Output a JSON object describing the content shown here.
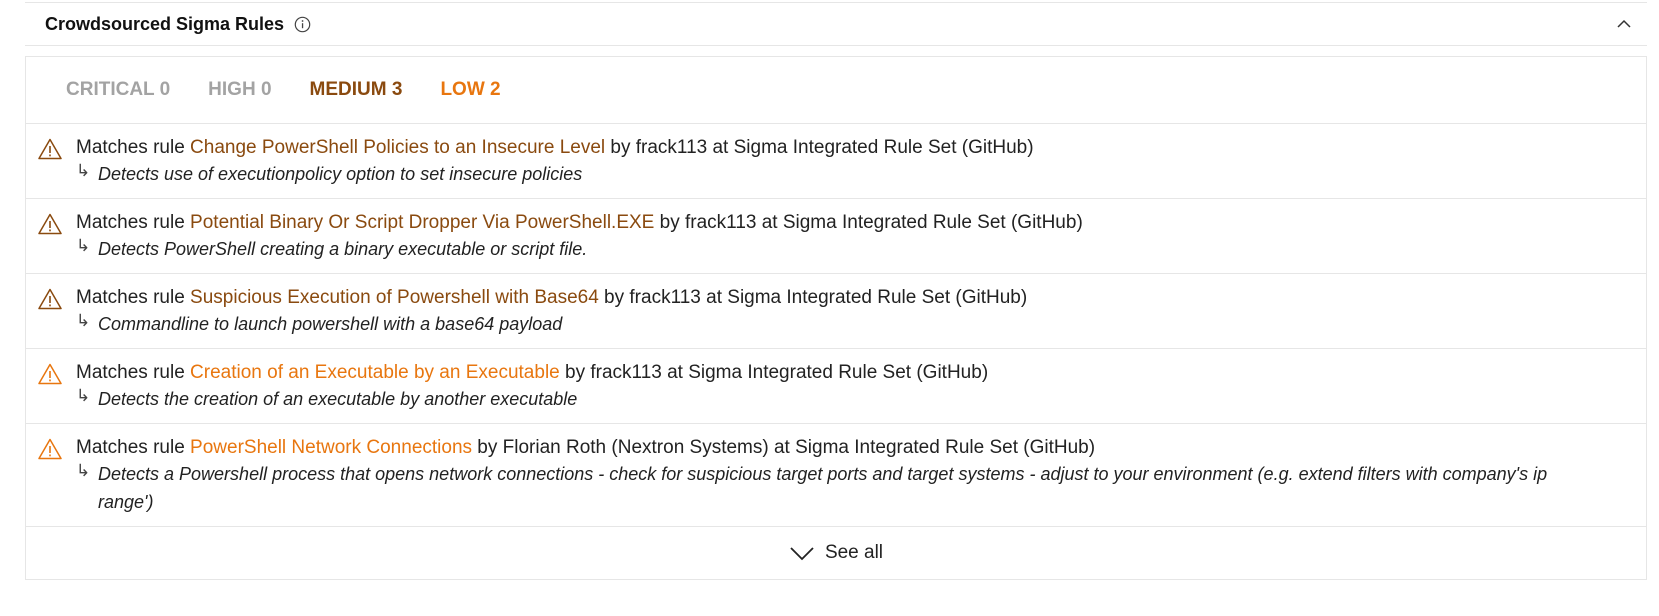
{
  "section": {
    "title": "Crowdsourced Sigma Rules"
  },
  "counts": {
    "critical": "CRITICAL 0",
    "high": "HIGH 0",
    "medium": "MEDIUM 3",
    "low": "LOW 2"
  },
  "colors": {
    "medium": "#8a4a0f",
    "low": "#e8760f",
    "muted": "#a3a3a3"
  },
  "rules": [
    {
      "prefix": "Matches rule ",
      "name": "Change PowerShell Policies to an Insecure Level",
      "suffix": " by frack113 at Sigma Integrated Rule Set (GitHub)",
      "description": "Detects use of executionpolicy option to set insecure policies",
      "severity": "medium"
    },
    {
      "prefix": "Matches rule ",
      "name": "Potential Binary Or Script Dropper Via PowerShell.EXE",
      "suffix": " by frack113 at Sigma Integrated Rule Set (GitHub)",
      "description": "Detects PowerShell creating a binary executable or script file.",
      "severity": "medium"
    },
    {
      "prefix": "Matches rule ",
      "name": "Suspicious Execution of Powershell with Base64",
      "suffix": " by frack113 at Sigma Integrated Rule Set (GitHub)",
      "description": "Commandline to launch powershell with a base64 payload",
      "severity": "medium"
    },
    {
      "prefix": "Matches rule ",
      "name": "Creation of an Executable by an Executable",
      "suffix": " by frack113 at Sigma Integrated Rule Set (GitHub)",
      "description": "Detects the creation of an executable by another executable",
      "severity": "low"
    },
    {
      "prefix": "Matches rule ",
      "name": "PowerShell Network Connections",
      "suffix": " by Florian Roth (Nextron Systems) at Sigma Integrated Rule Set (GitHub)",
      "description": "Detects a Powershell process that opens network connections - check for suspicious target ports and target systems - adjust to your environment (e.g. extend filters with company's ip range')",
      "severity": "low"
    }
  ],
  "see_all": "See all",
  "icons": {
    "info": "info-icon",
    "collapse": "chevron-up-icon",
    "warning": "warning-icon",
    "reply": "return-arrow-icon",
    "expand": "chevron-down-icon"
  }
}
